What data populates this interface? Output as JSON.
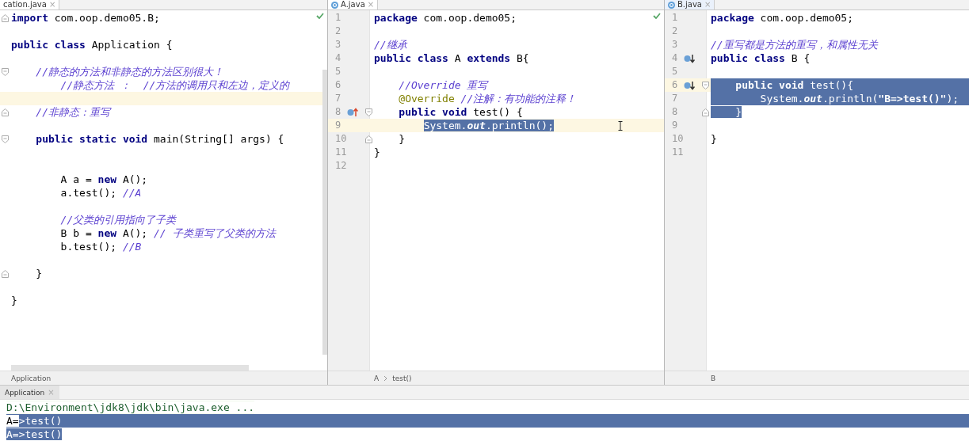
{
  "panes": [
    {
      "tab": {
        "label": "cation.java",
        "close": "×",
        "file_icon": false,
        "selected": false
      },
      "inspection_ok": true,
      "scrollbars": true,
      "text_cursor": false,
      "lines": [
        {
          "current": false,
          "markers": [
            {
              "kind": "fold_end"
            }
          ],
          "tokens": [
            {
              "kind": "kw",
              "text": "import",
              "selected": false
            },
            {
              "kind": "plain",
              "text": " com.oop.demo05.B;",
              "selected": false
            }
          ]
        },
        {
          "current": false
        },
        {
          "current": false,
          "tokens": [
            {
              "kind": "kw",
              "text": "public class ",
              "selected": false
            },
            {
              "kind": "plain",
              "text": "Application {",
              "selected": false
            }
          ]
        },
        {
          "current": false
        },
        {
          "current": false,
          "markers": [
            {
              "kind": "fold_start"
            }
          ],
          "tokens": [
            {
              "kind": "comment",
              "text": "    //静态的方法和非静态的方法区别很大！",
              "selected": false
            }
          ]
        },
        {
          "current": false,
          "tokens": [
            {
              "kind": "comment",
              "text": "        //静态方法 ：  //方法的调用只和左边，定义的",
              "selected": false
            }
          ]
        },
        {
          "current": true
        },
        {
          "current": false,
          "markers": [
            {
              "kind": "fold_end"
            }
          ],
          "tokens": [
            {
              "kind": "comment",
              "text": "    //非静态：重写",
              "selected": false
            }
          ]
        },
        {
          "current": false
        },
        {
          "current": false,
          "markers": [
            {
              "kind": "fold_start"
            }
          ],
          "tokens": [
            {
              "kind": "kw",
              "text": "    public static void ",
              "selected": false
            },
            {
              "kind": "plain",
              "text": "main(String[] args) {",
              "selected": false
            }
          ]
        },
        {
          "current": false
        },
        {
          "current": false
        },
        {
          "current": false,
          "tokens": [
            {
              "kind": "plain",
              "text": "        A a = ",
              "selected": false
            },
            {
              "kind": "kw",
              "text": "new ",
              "selected": false
            },
            {
              "kind": "plain",
              "text": "A();",
              "selected": false
            }
          ]
        },
        {
          "current": false,
          "tokens": [
            {
              "kind": "plain",
              "text": "        a.test(); ",
              "selected": false
            },
            {
              "kind": "comment",
              "text": "//A",
              "selected": false
            }
          ]
        },
        {
          "current": false
        },
        {
          "current": false,
          "tokens": [
            {
              "kind": "comment",
              "text": "        //父类的引用指向了子类",
              "selected": false
            }
          ]
        },
        {
          "current": false,
          "tokens": [
            {
              "kind": "plain",
              "text": "        B b = ",
              "selected": false
            },
            {
              "kind": "kw",
              "text": "new ",
              "selected": false
            },
            {
              "kind": "plain",
              "text": "A(); ",
              "selected": false
            },
            {
              "kind": "comment",
              "text": "// 子类重写了父类的方法",
              "selected": false
            }
          ]
        },
        {
          "current": false,
          "tokens": [
            {
              "kind": "plain",
              "text": "        b.test(); ",
              "selected": false
            },
            {
              "kind": "comment",
              "text": "//B",
              "selected": false
            }
          ]
        },
        {
          "current": false
        },
        {
          "current": false,
          "markers": [
            {
              "kind": "fold_end"
            }
          ],
          "tokens": [
            {
              "kind": "plain",
              "text": "    }",
              "selected": false
            }
          ]
        },
        {
          "current": false
        },
        {
          "current": false,
          "tokens": [
            {
              "kind": "plain",
              "text": "}",
              "selected": false
            }
          ]
        }
      ],
      "breadcrumb": [
        "Application"
      ]
    },
    {
      "tab": {
        "label": "A.java",
        "close": "×",
        "file_icon": true,
        "selected": false
      },
      "inspection_ok": true,
      "scrollbars": false,
      "text_cursor": true,
      "lines": [
        {
          "number": "1",
          "current": false,
          "tokens": [
            {
              "kind": "kw",
              "text": "package",
              "selected": false
            },
            {
              "kind": "plain",
              "text": " com.oop.demo05;",
              "selected": false
            }
          ]
        },
        {
          "number": "2",
          "current": false
        },
        {
          "number": "3",
          "current": false,
          "tokens": [
            {
              "kind": "comment",
              "text": "//继承",
              "selected": false
            }
          ]
        },
        {
          "number": "4",
          "current": false,
          "tokens": [
            {
              "kind": "kw",
              "text": "public class ",
              "selected": false
            },
            {
              "kind": "plain",
              "text": "A ",
              "selected": false
            },
            {
              "kind": "kw",
              "text": "extends ",
              "selected": false
            },
            {
              "kind": "plain",
              "text": "B{",
              "selected": false
            }
          ]
        },
        {
          "number": "5",
          "current": false
        },
        {
          "number": "6",
          "current": false,
          "tokens": [
            {
              "kind": "comment",
              "text": "    //Override 重写",
              "selected": false
            }
          ]
        },
        {
          "number": "7",
          "current": false,
          "tokens": [
            {
              "kind": "annotation",
              "text": "    @Override",
              "selected": false
            },
            {
              "kind": "comment",
              "text": " //注解：有功能的注释！",
              "selected": false
            }
          ]
        },
        {
          "number": "8",
          "current": false,
          "markers": [
            {
              "kind": "overrides"
            },
            {
              "kind": "fold_start"
            }
          ],
          "tokens": [
            {
              "kind": "kw",
              "text": "    public void ",
              "selected": false
            },
            {
              "kind": "plain",
              "text": "test() {",
              "selected": false
            }
          ]
        },
        {
          "number": "9",
          "current": true,
          "tokens": [
            {
              "kind": "plain",
              "text": "        System.",
              "selected": true
            },
            {
              "kind": "static",
              "text": "out",
              "selected": true
            },
            {
              "kind": "plain",
              "text": ".println();",
              "selected": true
            }
          ]
        },
        {
          "number": "10",
          "current": false,
          "markers": [
            {
              "kind": "fold_end"
            }
          ],
          "tokens": [
            {
              "kind": "plain",
              "text": "    }",
              "selected": false
            }
          ]
        },
        {
          "number": "11",
          "current": false,
          "tokens": [
            {
              "kind": "plain",
              "text": "}",
              "selected": false
            }
          ]
        },
        {
          "number": "12",
          "current": false
        }
      ],
      "breadcrumb": [
        "A",
        "test()"
      ]
    },
    {
      "tab": {
        "label": "B.java",
        "close": "×",
        "file_icon": true,
        "selected": true
      },
      "inspection_ok": false,
      "scrollbars": false,
      "text_cursor": false,
      "lines": [
        {
          "number": "1",
          "current": false,
          "tokens": [
            {
              "kind": "kw",
              "text": "package",
              "selected": false
            },
            {
              "kind": "plain",
              "text": " com.oop.demo05;",
              "selected": false
            }
          ]
        },
        {
          "number": "2",
          "current": false
        },
        {
          "number": "3",
          "current": false,
          "tokens": [
            {
              "kind": "comment",
              "text": "//重写都是方法的重写，和属性无关",
              "selected": false
            }
          ]
        },
        {
          "number": "4",
          "current": false,
          "markers": [
            {
              "kind": "overridden"
            }
          ],
          "tokens": [
            {
              "kind": "kw",
              "text": "public class ",
              "selected": false
            },
            {
              "kind": "plain",
              "text": "B {",
              "selected": false
            }
          ]
        },
        {
          "number": "5",
          "current": false
        },
        {
          "number": "6",
          "current": true,
          "markers": [
            {
              "kind": "overridden"
            },
            {
              "kind": "fold_start"
            }
          ],
          "tokens": [
            {
              "kind": "kw",
              "text": "    public void ",
              "selected": true
            },
            {
              "kind": "plain",
              "text": "test(){",
              "selected": true
            }
          ]
        },
        {
          "number": "7",
          "current": false,
          "tokens": [
            {
              "kind": "plain",
              "text": "        System.",
              "selected": true
            },
            {
              "kind": "static",
              "text": "out",
              "selected": true
            },
            {
              "kind": "plain",
              "text": ".println(",
              "selected": true
            },
            {
              "kind": "string",
              "text": "\"B=>test()\"",
              "selected": true
            },
            {
              "kind": "plain",
              "text": ");",
              "selected": true
            }
          ]
        },
        {
          "number": "8",
          "current": false,
          "markers": [
            {
              "kind": "fold_end"
            }
          ],
          "tokens": [
            {
              "kind": "plain",
              "text": "    }",
              "selected": true
            }
          ]
        },
        {
          "number": "9",
          "current": false
        },
        {
          "number": "10",
          "current": false,
          "tokens": [
            {
              "kind": "plain",
              "text": "}",
              "selected": false
            }
          ]
        },
        {
          "number": "11",
          "current": false
        }
      ],
      "breadcrumb": [
        "B"
      ]
    }
  ],
  "run_panel": {
    "tab": {
      "label": "Application",
      "close": "×"
    },
    "console": [
      {
        "kind": "command",
        "segments": [
          {
            "text": "D:\\Environment\\jdk8\\jdk\\bin\\java.exe ...",
            "selected": false
          }
        ]
      },
      {
        "kind": "output",
        "segments": [
          {
            "text": "A=",
            "selected": false
          },
          {
            "text": ">test()",
            "selected": true
          }
        ]
      },
      {
        "kind": "output",
        "segments": [
          {
            "text": "A=>test()",
            "selected": true
          }
        ]
      }
    ]
  }
}
